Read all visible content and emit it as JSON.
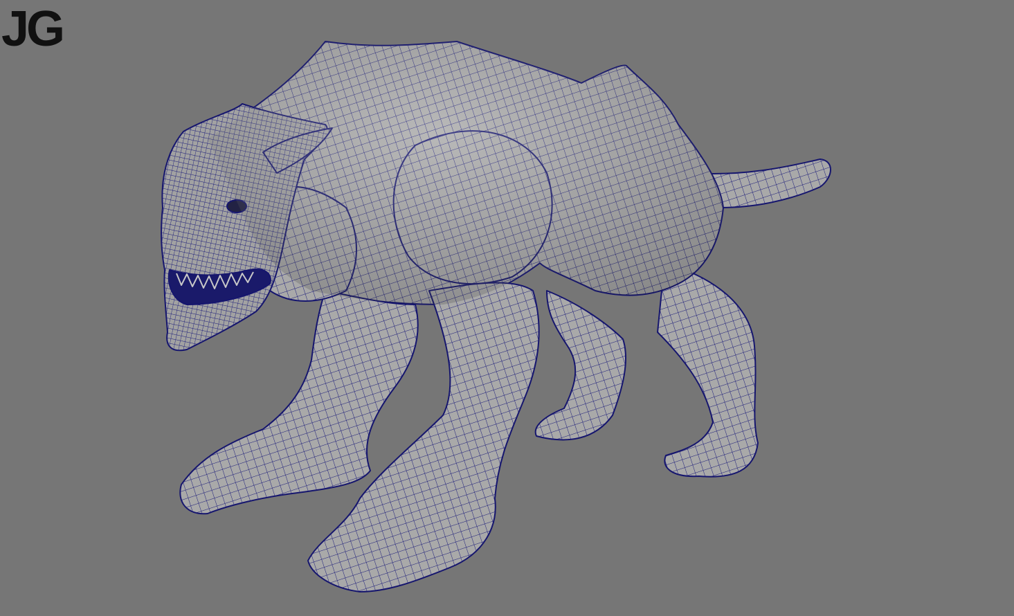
{
  "viewport": {
    "background_color": "#767676",
    "mesh_fill_color": "#a9a9a9",
    "wireframe_color": "#16166e",
    "subject": "creature-mesh"
  },
  "watermark": {
    "text": "JG",
    "color": "#111111"
  }
}
